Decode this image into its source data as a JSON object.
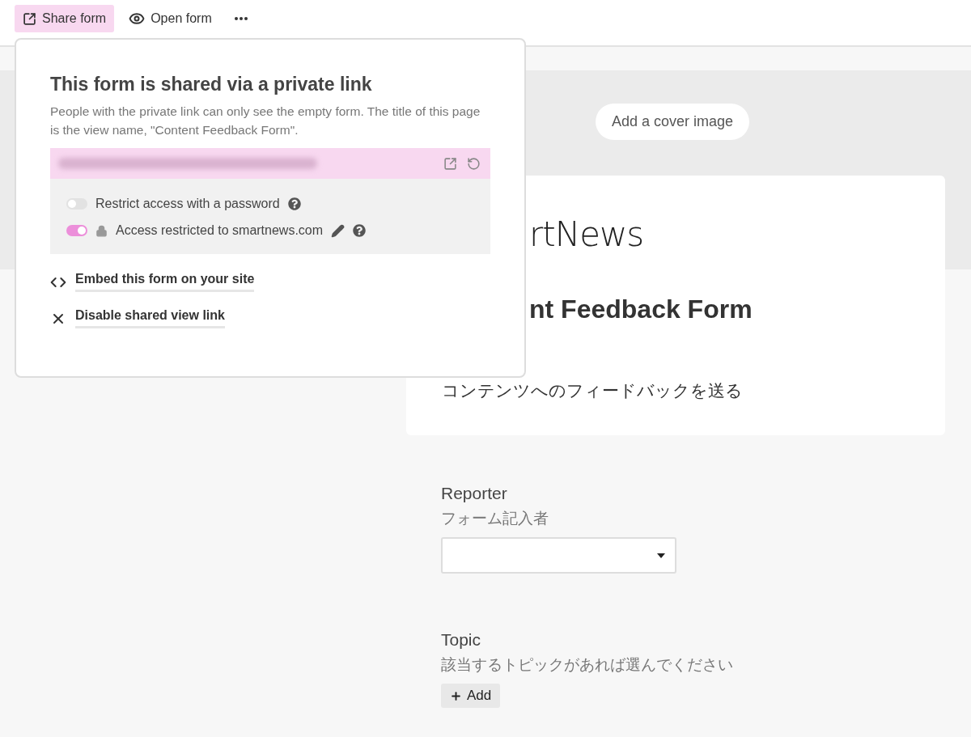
{
  "toolbar": {
    "buttons": [
      {
        "kind": "share",
        "label": "Share form",
        "selected": true
      },
      {
        "kind": "open",
        "label": "Open form",
        "selected": false
      },
      {
        "kind": "more",
        "selected": false
      }
    ]
  },
  "share_popup": {
    "title": "This form is shared via a private link",
    "description": "People with the private link can only see the empty form. The title of this page is the view name, \"Content Feedback Form\".",
    "toggles": [
      {
        "kind": "password",
        "label": "Restrict access with a password",
        "on": false
      },
      {
        "kind": "domain",
        "label": "Access restricted to smartnews.com",
        "on": true
      }
    ],
    "links": [
      {
        "kind": "embed",
        "label": "Embed this form on your site"
      },
      {
        "kind": "disable",
        "label": "Disable shared view link"
      }
    ]
  },
  "cover": {
    "button": "Add a cover image"
  },
  "form": {
    "logo_text": "rtNews",
    "title": "nt Feedback Form",
    "subtitle": "コンテンツへのフィードバックを送る",
    "fields": [
      {
        "kind": "select",
        "label": "Reporter",
        "description": "フォーム記入者"
      },
      {
        "kind": "multi",
        "label": "Topic",
        "description": "該当するトピックがあれば選んでください",
        "button": "Add"
      }
    ]
  }
}
